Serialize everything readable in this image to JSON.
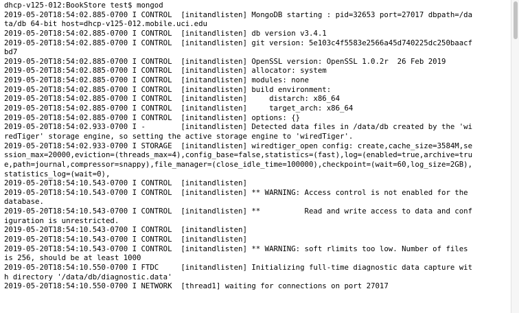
{
  "terminal": {
    "lines": [
      "dhcp-v125-012:BookStore test$ mongod",
      "2019-05-20T18:54:02.885-0700 I CONTROL  [initandlisten] MongoDB starting : pid=32653 port=27017 dbpath=/da",
      "ta/db 64-bit host=dhcp-v125-012.mobile.uci.edu",
      "2019-05-20T18:54:02.885-0700 I CONTROL  [initandlisten] db version v3.4.1",
      "2019-05-20T18:54:02.885-0700 I CONTROL  [initandlisten] git version: 5e103c4f5583e2566a45d740225dc250baacf",
      "bd7",
      "2019-05-20T18:54:02.885-0700 I CONTROL  [initandlisten] OpenSSL version: OpenSSL 1.0.2r  26 Feb 2019",
      "2019-05-20T18:54:02.885-0700 I CONTROL  [initandlisten] allocator: system",
      "2019-05-20T18:54:02.885-0700 I CONTROL  [initandlisten] modules: none",
      "2019-05-20T18:54:02.885-0700 I CONTROL  [initandlisten] build environment:",
      "2019-05-20T18:54:02.885-0700 I CONTROL  [initandlisten]     distarch: x86_64",
      "2019-05-20T18:54:02.885-0700 I CONTROL  [initandlisten]     target_arch: x86_64",
      "2019-05-20T18:54:02.885-0700 I CONTROL  [initandlisten] options: {}",
      "2019-05-20T18:54:02.933-0700 I -        [initandlisten] Detected data files in /data/db created by the 'wi",
      "redTiger' storage engine, so setting the active storage engine to 'wiredTiger'.",
      "2019-05-20T18:54:02.933-0700 I STORAGE  [initandlisten] wiredtiger_open config: create,cache_size=3584M,se",
      "ssion_max=20000,eviction=(threads_max=4),config_base=false,statistics=(fast),log=(enabled=true,archive=tru",
      "e,path=journal,compressor=snappy),file_manager=(close_idle_time=100000),checkpoint=(wait=60,log_size=2GB),",
      "statistics_log=(wait=0),",
      "2019-05-20T18:54:10.543-0700 I CONTROL  [initandlisten]",
      "2019-05-20T18:54:10.543-0700 I CONTROL  [initandlisten] ** WARNING: Access control is not enabled for the",
      "database.",
      "2019-05-20T18:54:10.543-0700 I CONTROL  [initandlisten] **          Read and write access to data and conf",
      "iguration is unrestricted.",
      "2019-05-20T18:54:10.543-0700 I CONTROL  [initandlisten]",
      "2019-05-20T18:54:10.543-0700 I CONTROL  [initandlisten]",
      "2019-05-20T18:54:10.543-0700 I CONTROL  [initandlisten] ** WARNING: soft rlimits too low. Number of files",
      "is 256, should be at least 1000",
      "2019-05-20T18:54:10.550-0700 I FTDC     [initandlisten] Initializing full-time diagnostic data capture wit",
      "h directory '/data/db/diagnostic.data'",
      "2019-05-20T18:54:10.550-0700 I NETWORK  [thread1] waiting for connections on port 27017"
    ]
  },
  "colors": {
    "background": "#ffffff",
    "text": "#000000",
    "scrollbar_thumb": "#c2c2c2"
  }
}
